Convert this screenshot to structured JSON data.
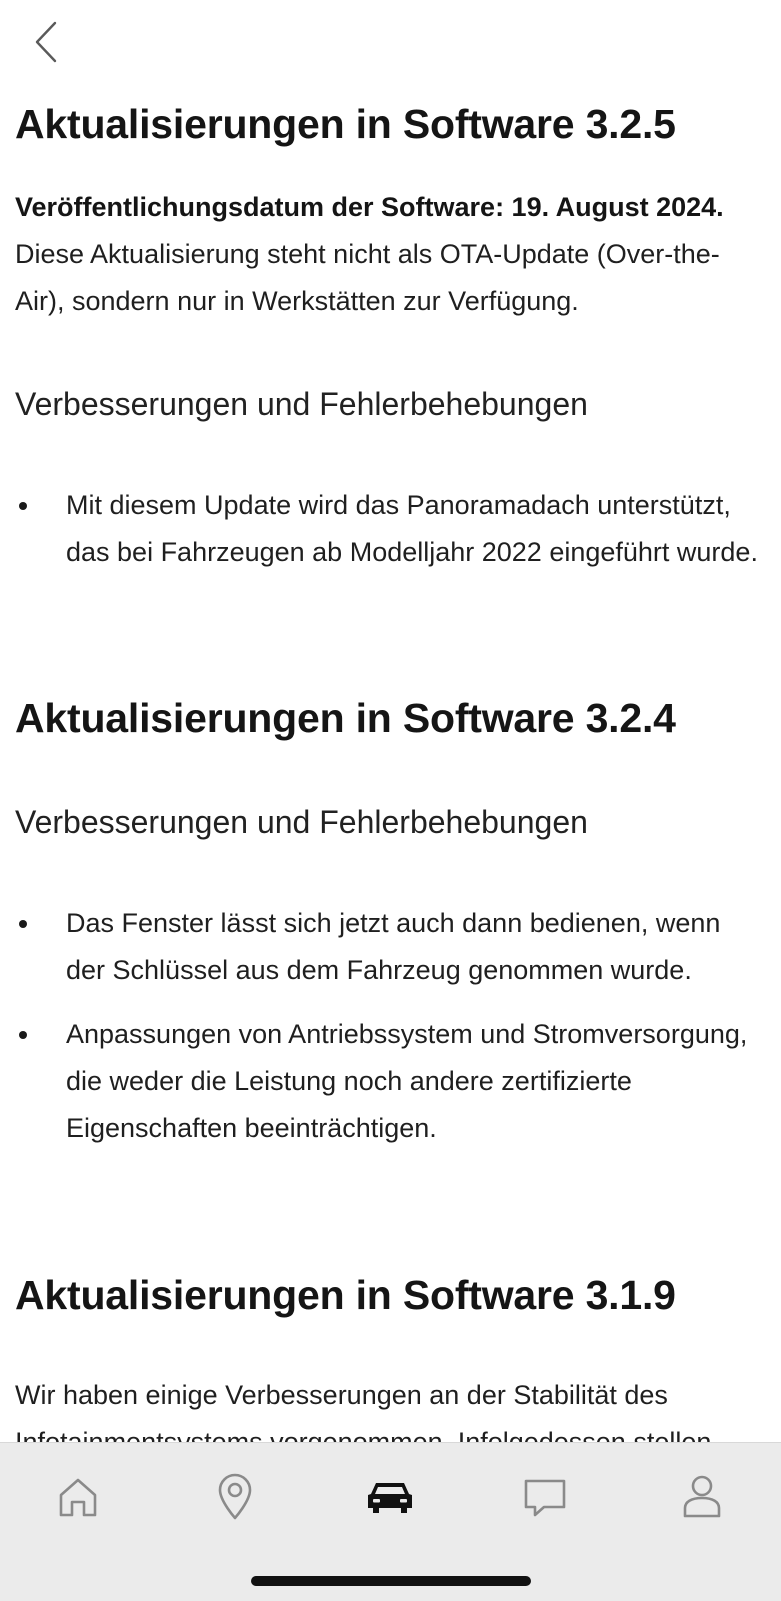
{
  "nav": {
    "back_icon": "chevron-left-icon"
  },
  "sections": [
    {
      "title": "Aktualisierungen in Software 3.2.5",
      "release_bold": "Veröffentlichungsdatum der Software: 19. August 2024.",
      "release_text": " Diese Aktualisierung steht nicht als OTA-Update (Over-the-Air), sondern nur in Werkstätten zur Verfügung.",
      "subheading": "Verbesserungen und Fehlerbehebungen",
      "bullets": [
        "Mit diesem Update wird das Panoramadach unterstützt, das bei Fahrzeugen ab Modelljahr 2022 eingeführt wurde."
      ]
    },
    {
      "title": "Aktualisierungen in Software 3.2.4",
      "subheading": "Verbesserungen und Fehlerbehebungen",
      "bullets": [
        "Das Fenster lässt sich jetzt auch dann bedienen, wenn der Schlüssel aus dem Fahrzeug genommen wurde.",
        "Anpassungen von Antriebssystem und Stromversorgung, die weder die Leistung noch andere zertifizierte Eigenschaften beeinträchtigen."
      ]
    },
    {
      "title": "Aktualisierungen in Software 3.1.9",
      "paragraph": "Wir haben einige Verbesserungen an der Stabilität des Infotainmentsystems vorgenommen. Infolgedessen stellen"
    }
  ],
  "tab_bar": {
    "tabs": [
      {
        "icon": "home-icon",
        "active": false
      },
      {
        "icon": "location-pin-icon",
        "active": false
      },
      {
        "icon": "car-icon",
        "active": true
      },
      {
        "icon": "chat-bubble-icon",
        "active": false
      },
      {
        "icon": "profile-icon",
        "active": false
      }
    ],
    "active_color": "#111111",
    "inactive_color": "#8a8a8a",
    "background": "#ebebeb"
  }
}
